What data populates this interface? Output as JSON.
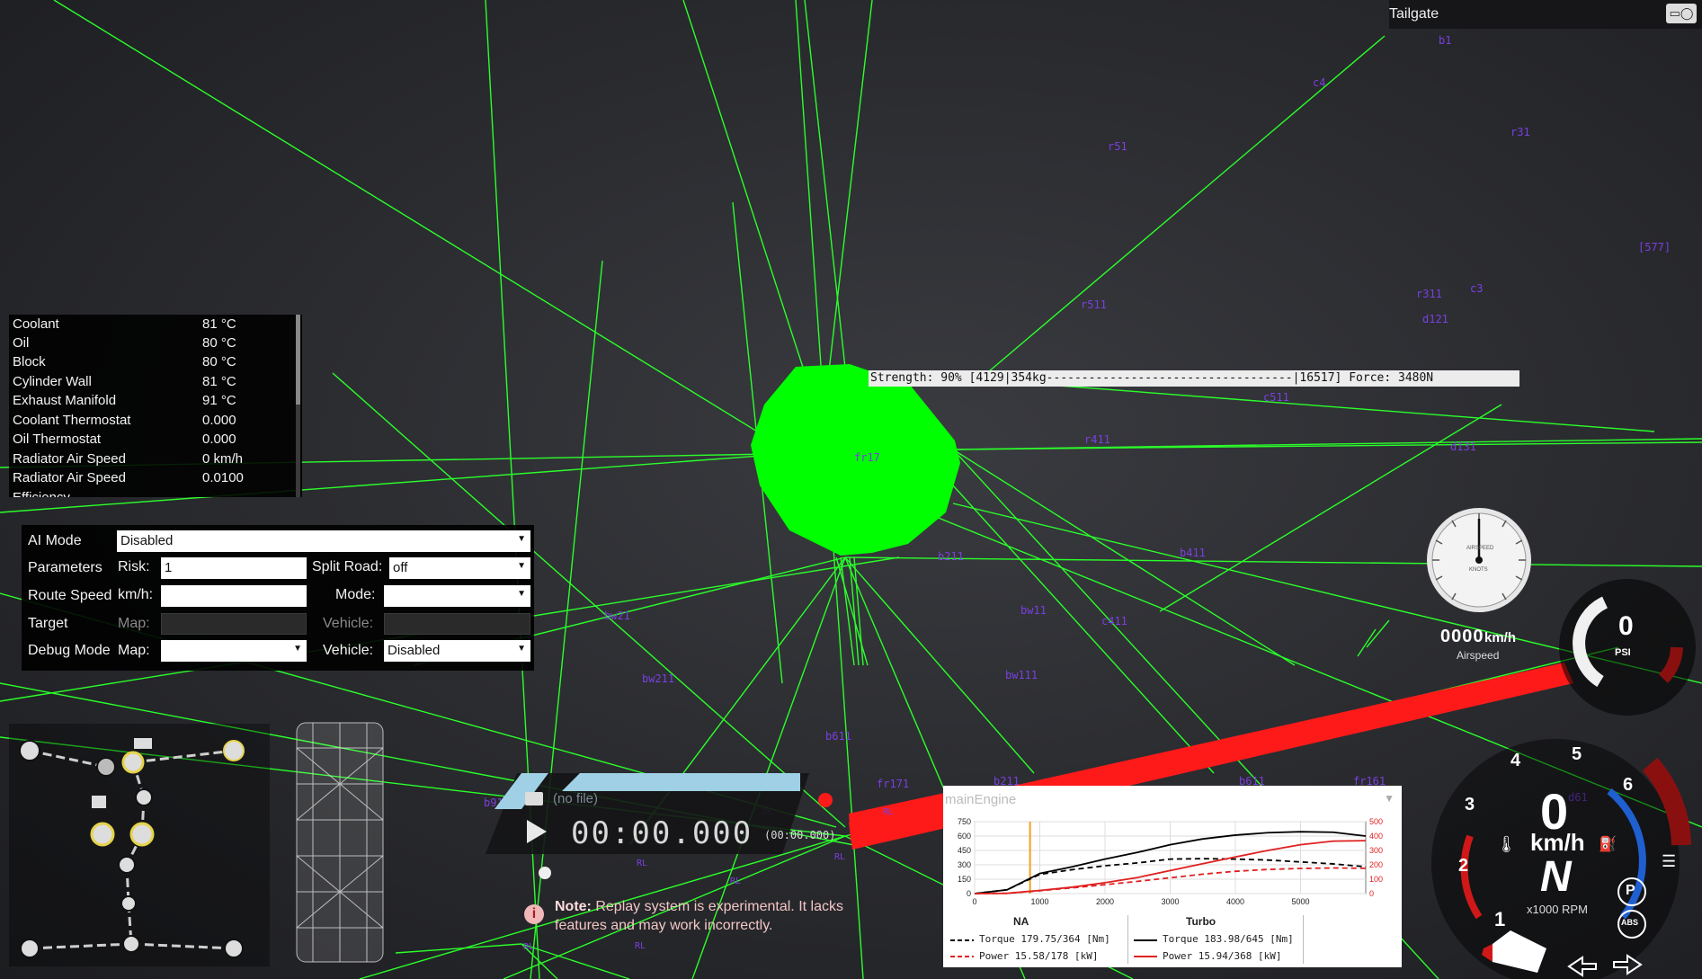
{
  "window": {
    "title": "Tailgate"
  },
  "node_labels": [
    "b1",
    "c4",
    "r51",
    "r31",
    "[577]",
    "r311",
    "c3",
    "d121",
    "r511",
    "c511",
    "r411",
    "d131",
    "fr17",
    "b211",
    "b411",
    "bw11",
    "c411",
    "bw111",
    "bw21",
    "bw211",
    "b611",
    "b911",
    "fr171",
    "b211",
    "b611",
    "fr161",
    "d61",
    "RL",
    "RL",
    "RL",
    "RL",
    "RL",
    "RL",
    "RL"
  ],
  "beam_readout": "Strength: 90% [4129|354kg-----------------------------------|16517] Force: 3480N",
  "temps": [
    {
      "label": "Coolant",
      "value": "81 °C"
    },
    {
      "label": "Oil",
      "value": "80 °C"
    },
    {
      "label": "Block",
      "value": "80 °C"
    },
    {
      "label": "Cylinder Wall",
      "value": "81 °C"
    },
    {
      "label": "Exhaust Manifold",
      "value": "91 °C"
    },
    {
      "label": "Coolant Thermostat",
      "value": "0.000"
    },
    {
      "label": "Oil Thermostat",
      "value": "0.000"
    },
    {
      "label": "Radiator Air Speed",
      "value": "0 km/h"
    },
    {
      "label": "Radiator Air Speed",
      "value": "0.0100"
    },
    {
      "label": "Efficiency",
      "value": ""
    }
  ],
  "ai": {
    "ai_mode_label": "AI Mode",
    "ai_mode_value": "Disabled",
    "parameters_label": "Parameters",
    "risk_label": "Risk:",
    "risk_value": "1",
    "split_road_label": "Split Road:",
    "split_road_value": "off",
    "route_speed_label": "Route Speed",
    "kmh_label": "km/h:",
    "route_speed_value": "",
    "mode_label": "Mode:",
    "mode_value": "",
    "target_label": "Target",
    "map_label": "Map:",
    "vehicle_label": "Vehicle:",
    "debug_mode_label": "Debug Mode",
    "debug_map_value": "",
    "debug_vehicle_value": "Disabled"
  },
  "replay": {
    "file": "(no file)",
    "time": "00:00.000",
    "time_small": "(00:00.000)",
    "note_bold": "Note:",
    "note_text": " Replay system is experimental. It lacks features and may work incorrectly."
  },
  "engine": {
    "title": "mainEngine",
    "na_label": "NA",
    "turbo_label": "Turbo",
    "na_torque": "Torque 179.75/364 [Nm]",
    "na_power": "Power 15.58/178  [kW]",
    "turbo_torque": "Torque 183.98/645 [Nm]",
    "turbo_power": "Power 15.94/368  [kW]"
  },
  "chart_data": {
    "type": "line",
    "title": "mainEngine",
    "x": [
      0,
      500,
      1000,
      1500,
      2000,
      2500,
      3000,
      3500,
      4000,
      4500,
      5000,
      5500,
      6000
    ],
    "xticks": [
      0,
      1000,
      2000,
      3000,
      4000,
      5000
    ],
    "y_left_ticks": [
      0,
      150,
      300,
      450,
      600,
      750
    ],
    "y_right_ticks": [
      0,
      100,
      200,
      300,
      400,
      500
    ],
    "ylim_left": [
      0,
      750
    ],
    "ylim_right": [
      0,
      500
    ],
    "rpm_marker": 850,
    "series": [
      {
        "name": "Torque",
        "group": "NA",
        "axis": "left",
        "style": "dashed",
        "color": "#000000",
        "values": [
          0,
          40,
          200,
          250,
          290,
          320,
          360,
          364,
          360,
          350,
          330,
          310,
          280
        ]
      },
      {
        "name": "Power",
        "group": "NA",
        "axis": "right",
        "style": "dashed",
        "color": "#e02020",
        "values": [
          0,
          2,
          20,
          40,
          62,
          85,
          110,
          135,
          155,
          168,
          175,
          178,
          176
        ]
      },
      {
        "name": "Torque",
        "group": "Turbo",
        "axis": "left",
        "style": "solid",
        "color": "#000000",
        "values": [
          0,
          40,
          210,
          280,
          360,
          430,
          510,
          570,
          610,
          635,
          645,
          640,
          600
        ]
      },
      {
        "name": "Power",
        "group": "Turbo",
        "axis": "right",
        "style": "solid",
        "color": "#e02020",
        "values": [
          0,
          2,
          22,
          45,
          76,
          112,
          160,
          208,
          255,
          300,
          340,
          365,
          368
        ]
      }
    ]
  },
  "airspeed": {
    "value": "0000",
    "unit": "km/h",
    "label": "Airspeed",
    "dial_text": "AIRSPEED",
    "dial_unit": "KNOTS"
  },
  "boost": {
    "value": "0",
    "unit": "PSI"
  },
  "speedo": {
    "speed": "0",
    "unit": "km/h",
    "gear": "N",
    "rpm_label": "x1000 RPM",
    "gear_marks": [
      "1",
      "2",
      "3",
      "4",
      "5",
      "6"
    ]
  },
  "colors": {
    "node_green": "#00ff00",
    "beam_green": "#2aff2a",
    "red_beam": "#ff1a1a",
    "node_purple": "#7a3fe0"
  }
}
